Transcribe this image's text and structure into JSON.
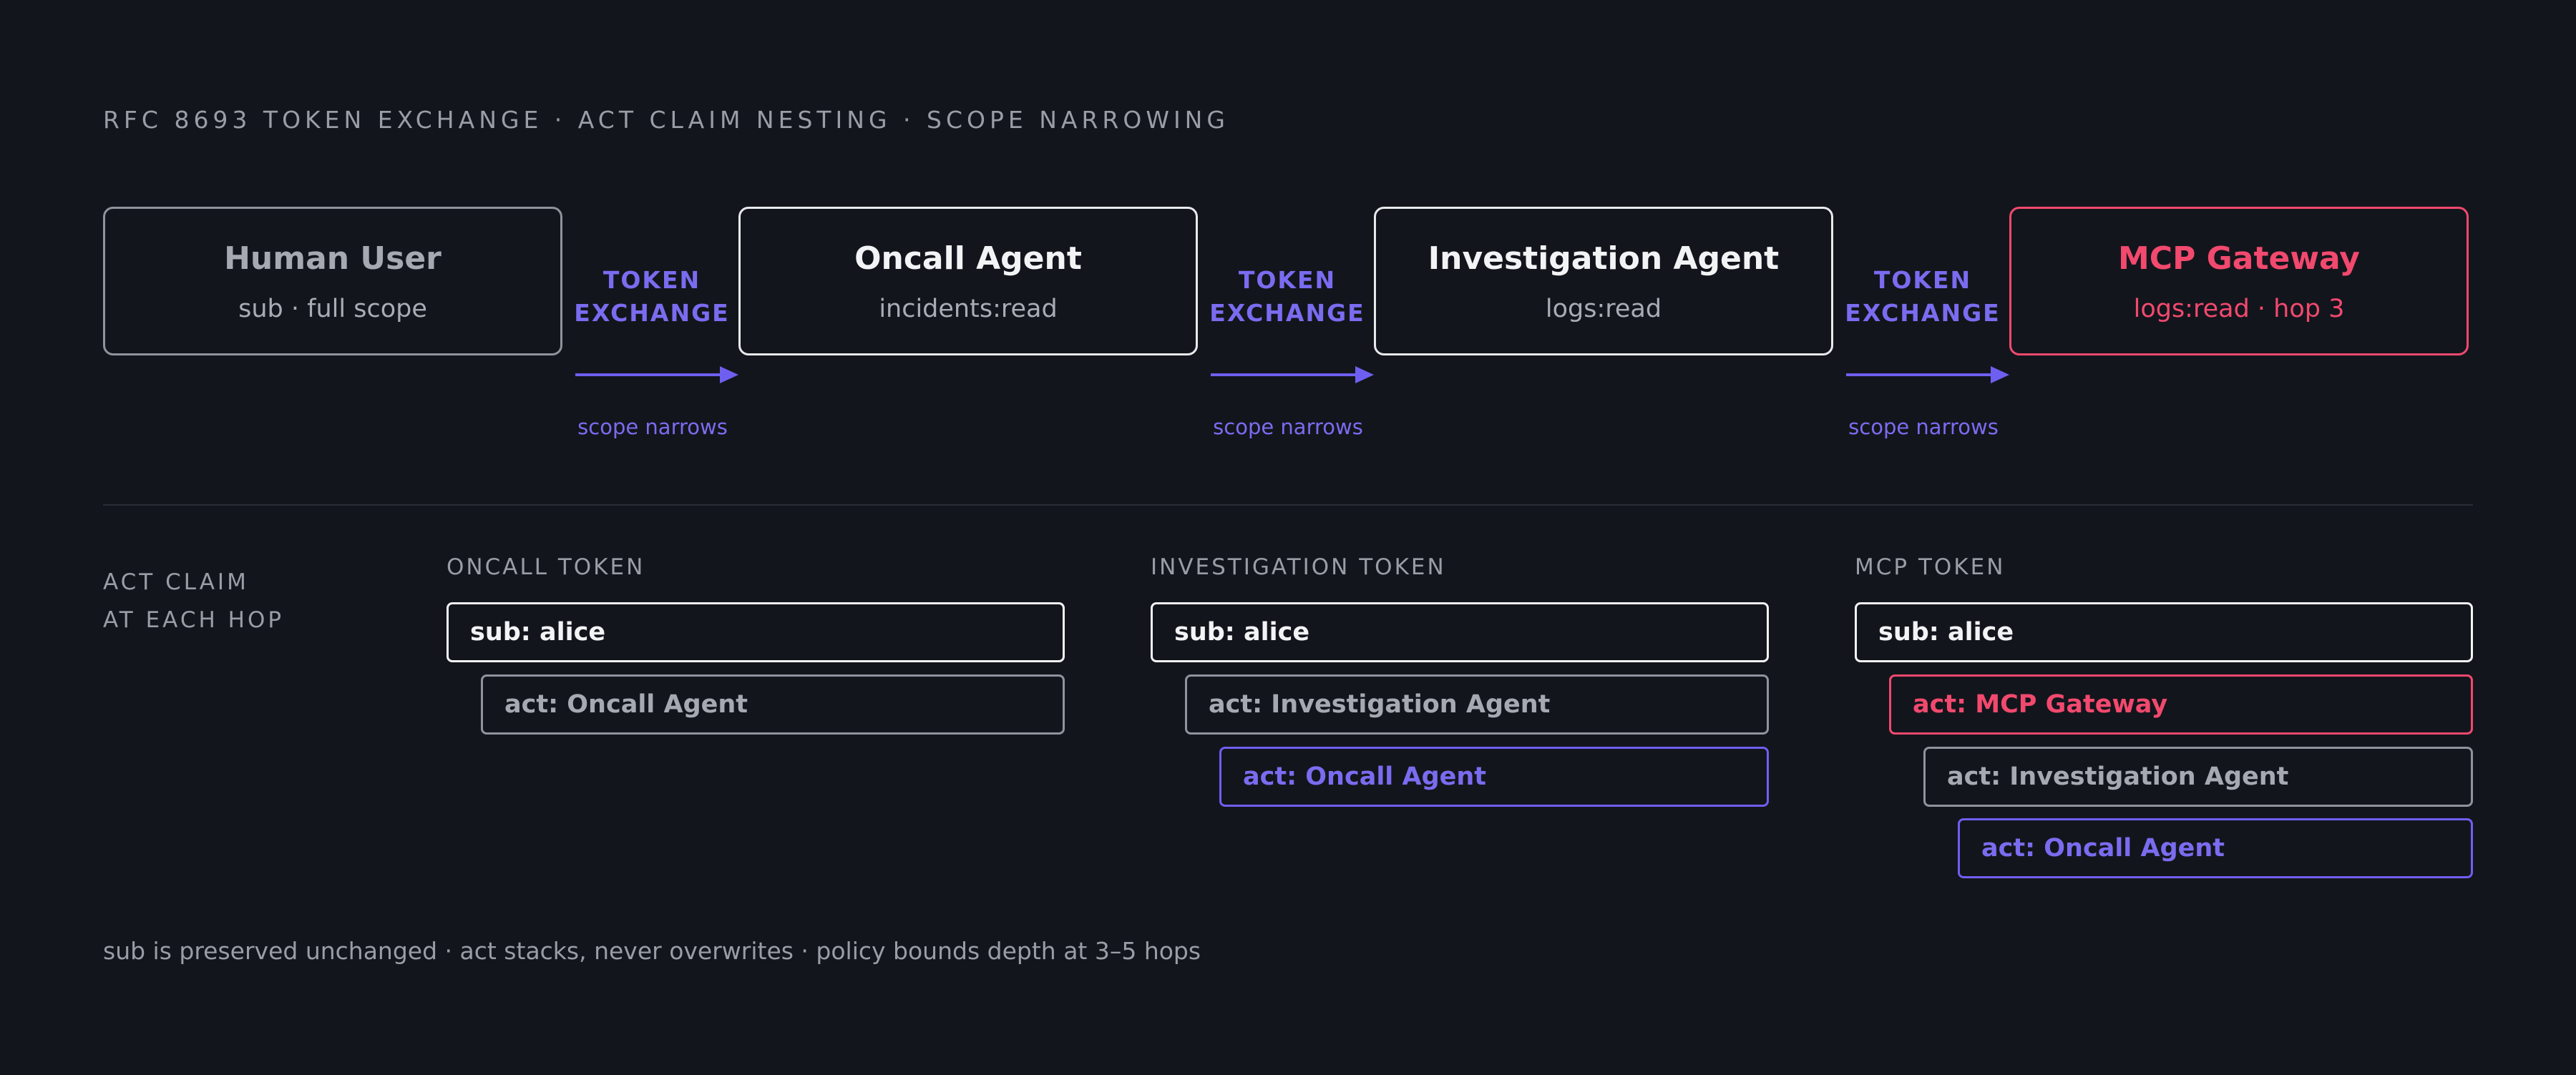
{
  "title": "RFC 8693 TOKEN EXCHANGE · ACT CLAIM NESTING · SCOPE NARROWING",
  "nodes": [
    {
      "name": "Human User",
      "scope": "sub · full scope"
    },
    {
      "name": "Oncall Agent",
      "scope": "incidents:read"
    },
    {
      "name": "Investigation Agent",
      "scope": "logs:read"
    },
    {
      "name": "MCP Gateway",
      "scope": "logs:read · hop 3"
    }
  ],
  "exchange": {
    "label_line1": "TOKEN",
    "label_line2": "EXCHANGE",
    "arrow_caption": "scope narrows"
  },
  "act_section": {
    "heading_line1": "ACT CLAIM",
    "heading_line2": "AT EACH HOP",
    "columns": [
      {
        "title": "ONCALL TOKEN",
        "entries": [
          "sub: alice",
          "act: Oncall Agent"
        ]
      },
      {
        "title": "INVESTIGATION TOKEN",
        "entries": [
          "sub: alice",
          "act: Investigation Agent",
          "act: Oncall Agent"
        ]
      },
      {
        "title": "MCP TOKEN",
        "entries": [
          "sub: alice",
          "act: MCP Gateway",
          "act: Investigation Agent",
          "act: Oncall Agent"
        ]
      }
    ]
  },
  "footer": "sub is preserved unchanged · act stacks, never overwrites · policy bounds depth at 3–5 hops",
  "colors": {
    "background": "#13151c",
    "accent_purple": "#6f5ff0",
    "accent_red": "#f2496e",
    "text_primary": "#f2f3f5",
    "text_muted": "#9a9da6"
  }
}
